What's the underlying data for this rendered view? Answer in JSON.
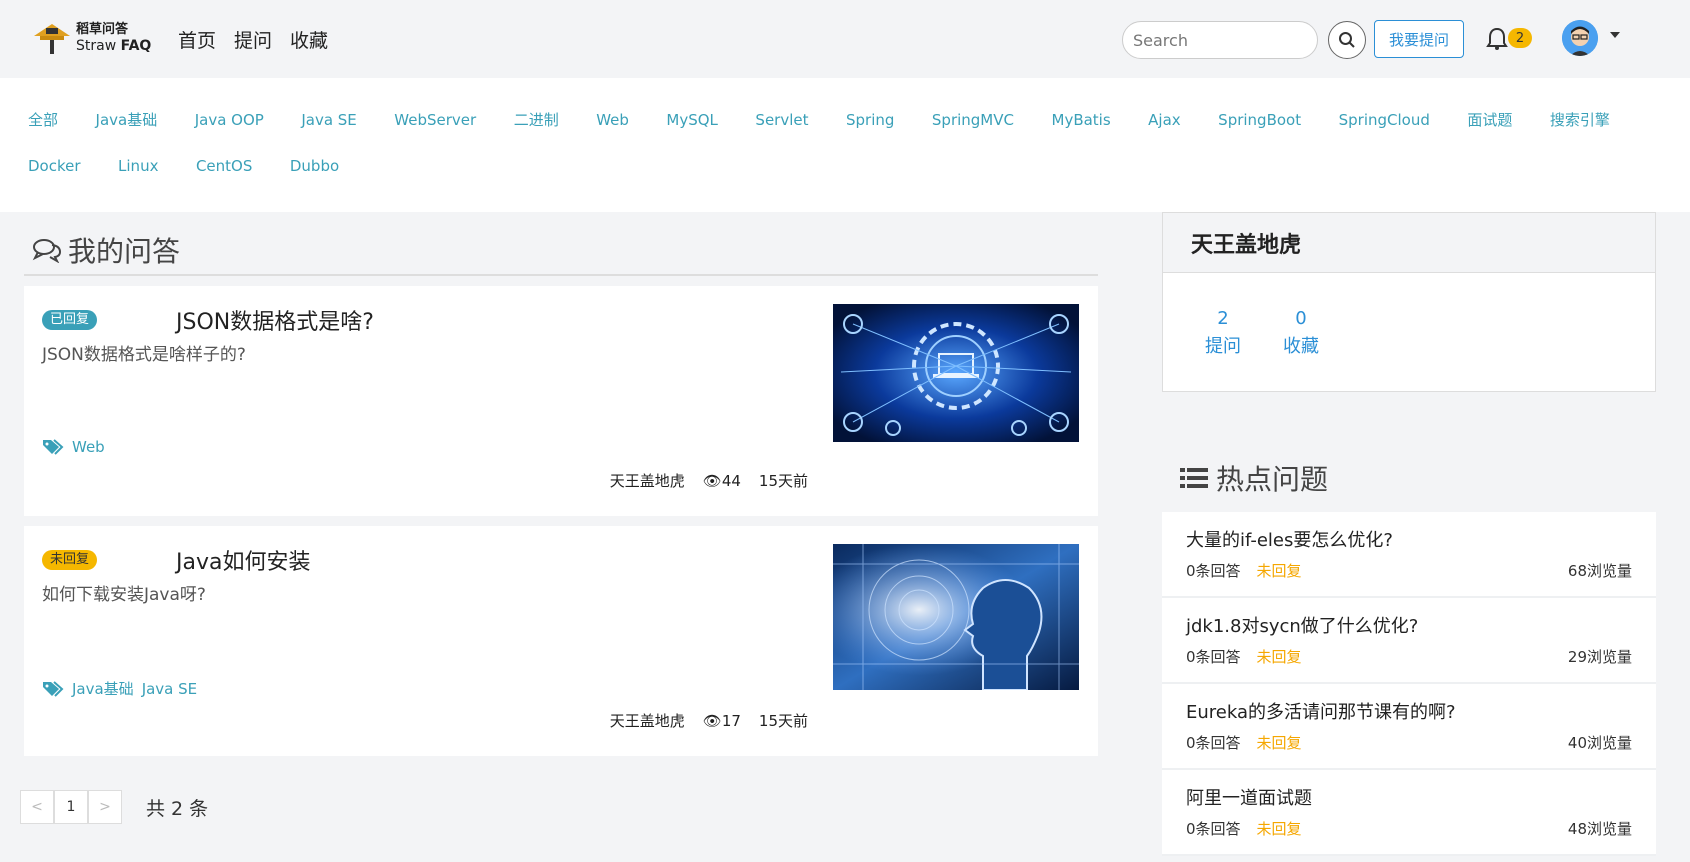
{
  "header": {
    "logo_cn": "稻草问答",
    "logo_en_prefix": "Straw ",
    "logo_en_suffix": "FAQ",
    "nav": [
      "首页",
      "提问",
      "收藏"
    ],
    "search_placeholder": "Search",
    "ask_label": "我要提问",
    "notification_count": "2"
  },
  "tags": [
    "全部",
    "Java基础",
    "Java OOP",
    "Java SE",
    "WebServer",
    "二进制",
    "Web",
    "MySQL",
    "Servlet",
    "Spring",
    "SpringMVC",
    "MyBatis",
    "Ajax",
    "SpringBoot",
    "SpringCloud",
    "面试题",
    "搜索引擎",
    "Docker",
    "Linux",
    "CentOS",
    "Dubbo"
  ],
  "main": {
    "section_title": "我的问答",
    "questions": [
      {
        "status": "已回复",
        "title": "JSON数据格式是啥?",
        "desc": "JSON数据格式是啥样子的?",
        "tags": [
          "Web"
        ],
        "author": "天王盖地虎",
        "views": "44",
        "time": "15天前"
      },
      {
        "status": "未回复",
        "title": "Java如何安装",
        "desc": "如何下载安装Java呀?",
        "tags": [
          "Java基础",
          "Java SE"
        ],
        "author": "天王盖地虎",
        "views": "17",
        "time": "15天前"
      }
    ],
    "pager": {
      "prev": "<",
      "page": "1",
      "next": ">",
      "total": "共 2 条"
    }
  },
  "sidebar": {
    "profile_name": "天王盖地虎",
    "stats": [
      {
        "value": "2",
        "label": "提问"
      },
      {
        "value": "0",
        "label": "收藏"
      }
    ],
    "hot_title": "热点问题",
    "hot": [
      {
        "title": "大量的if-eles要怎么优化?",
        "answers": "0条回答",
        "status": "未回复",
        "views": "68浏览量"
      },
      {
        "title": "jdk1.8对sycn做了什么优化?",
        "answers": "0条回答",
        "status": "未回复",
        "views": "29浏览量"
      },
      {
        "title": "Eureka的多活请问那节课有的啊?",
        "answers": "0条回答",
        "status": "未回复",
        "views": "40浏览量"
      },
      {
        "title": "阿里一道面试题",
        "answers": "0条回答",
        "status": "未回复",
        "views": "48浏览量"
      }
    ]
  },
  "colors": {
    "accent": "#3aa0b8",
    "link_blue": "#2b8fd6",
    "warning": "#f5b700"
  }
}
